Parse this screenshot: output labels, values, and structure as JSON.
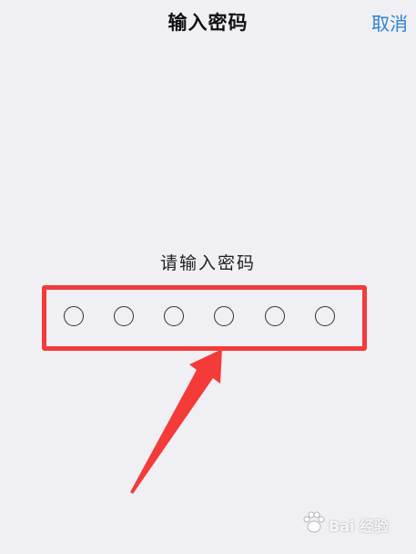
{
  "nav": {
    "title": "输入密码",
    "cancel_label": "取消"
  },
  "prompt": "请输入密码",
  "pin": {
    "length": 6,
    "filled": 0
  },
  "watermark": {
    "text": "Bai 经验",
    "icon": "paw-icon"
  },
  "colors": {
    "accent": "#2f80d0",
    "highlight": "#f53a3a",
    "background": "#efeff4"
  }
}
